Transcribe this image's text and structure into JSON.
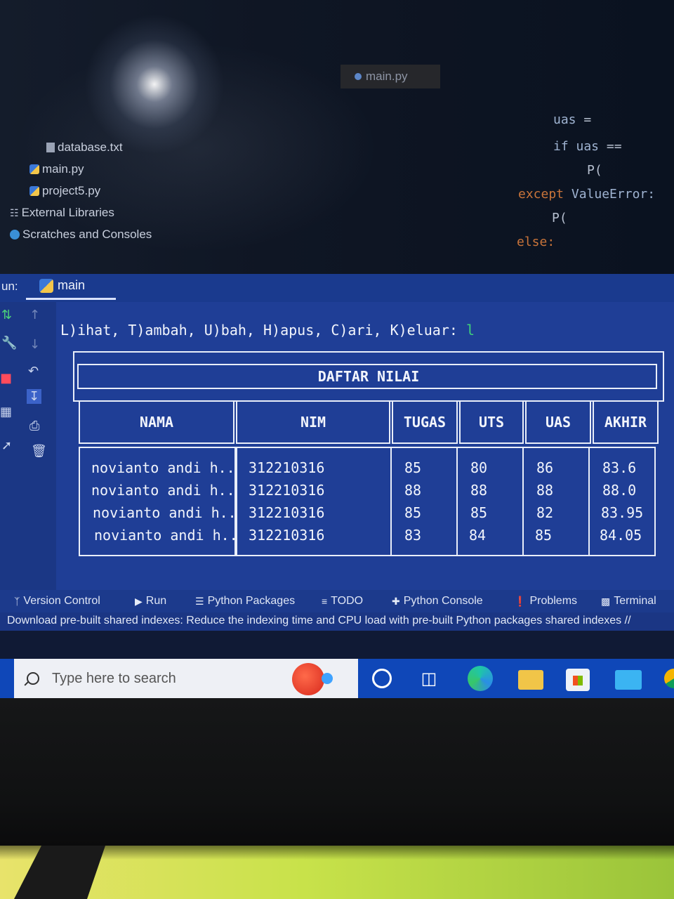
{
  "editor": {
    "tab_label": "main.py",
    "code_lines": [
      {
        "a": "uas",
        "b": " = "
      },
      {
        "a": "if uas",
        "b": " =="
      },
      {
        "a": "P(",
        "b": ""
      },
      {
        "a": "except",
        "b": " ValueError:"
      },
      {
        "a": "P(",
        "b": ""
      },
      {
        "a": "else:",
        "b": ""
      }
    ]
  },
  "project_tree": {
    "items": [
      {
        "label": "database.txt",
        "icon": "text-file-icon"
      },
      {
        "label": "main.py",
        "icon": "python-file-icon"
      },
      {
        "label": "project5.py",
        "icon": "python-file-icon"
      },
      {
        "label": "External Libraries",
        "icon": "libraries-icon"
      },
      {
        "label": "Scratches and Consoles",
        "icon": "scratches-icon"
      }
    ]
  },
  "run_panel": {
    "label": "un:",
    "tab": "main"
  },
  "console": {
    "prompt": "L)ihat, T)ambah, U)bah, H)apus, C)ari, K)eluar: ",
    "input": "l",
    "table_title": "DAFTAR NILAI",
    "headers": [
      "NAMA",
      "NIM",
      "TUGAS",
      "UTS",
      "UAS",
      "AKHIR"
    ],
    "rows": [
      [
        "novianto andi h..",
        "312210316",
        "85",
        "80",
        "86",
        "83.6"
      ],
      [
        "novianto andi h..",
        "312210316",
        "88",
        "88",
        "88",
        "88.0"
      ],
      [
        "novianto andi h..",
        "312210316",
        "85",
        "85",
        "82",
        "83.95"
      ],
      [
        "novianto andi h..",
        "312210316",
        "83",
        "84",
        "85",
        "84.05"
      ]
    ]
  },
  "tool_windows": [
    {
      "label": "Version Control",
      "icon": "version-control-icon"
    },
    {
      "label": "Run",
      "icon": "run-icon"
    },
    {
      "label": "Python Packages",
      "icon": "packages-icon"
    },
    {
      "label": "TODO",
      "icon": "todo-icon"
    },
    {
      "label": "Python Console",
      "icon": "python-console-icon"
    },
    {
      "label": "Problems",
      "icon": "problems-icon"
    },
    {
      "label": "Terminal",
      "icon": "terminal-icon"
    }
  ],
  "status_message": "Download pre-built shared indexes: Reduce the indexing time and CPU load with pre-built Python packages shared indexes //",
  "taskbar": {
    "search_placeholder": "Type here to search"
  }
}
